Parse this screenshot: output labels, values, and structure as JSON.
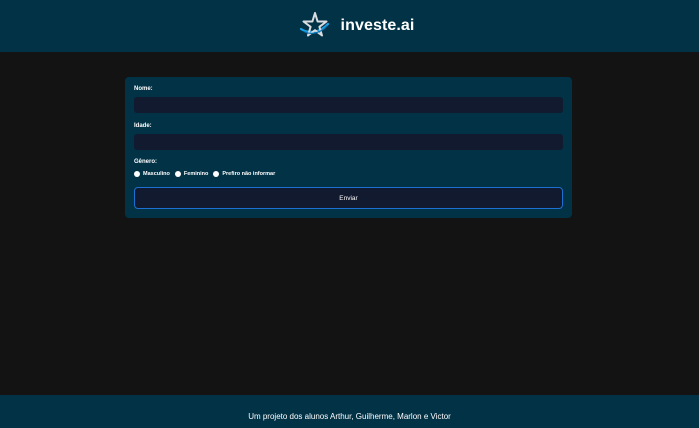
{
  "header": {
    "brand_name": "investe.ai",
    "logo_icon": "star-logo-icon"
  },
  "form": {
    "name_label": "Nome:",
    "name_value": "",
    "age_label": "Idade:",
    "age_value": "",
    "gender_label": "Gênero:",
    "gender_options": [
      {
        "label": "Masculino",
        "selected": false
      },
      {
        "label": "Feminino",
        "selected": false
      },
      {
        "label": "Prefiro não informar",
        "selected": false
      }
    ],
    "submit_label": "Enviar"
  },
  "footer": {
    "text": "Um projeto dos alunos Arthur, Guilherme, Marlon e Victor"
  },
  "colors": {
    "header_bg": "#023246",
    "page_bg": "#131313",
    "input_bg": "#111a2e",
    "button_border": "#1d6fd1"
  }
}
